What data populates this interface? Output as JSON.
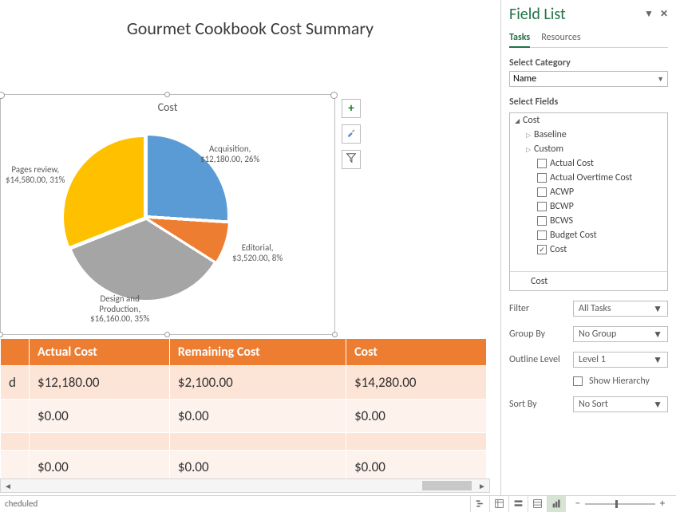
{
  "report": {
    "title": "Gourmet Cookbook Cost Summary",
    "chart_title": "Cost"
  },
  "chart_data": {
    "type": "pie",
    "title": "Cost",
    "series": [
      {
        "name": "Acquisition",
        "value": 12180.0,
        "pct": 26,
        "label": "Acquisition,\n$12,180.00, 26%",
        "color": "#5b9bd5"
      },
      {
        "name": "Editorial",
        "value": 3520.0,
        "pct": 8,
        "label": "Editorial,\n$3,520.00, 8%",
        "color": "#ed7d31"
      },
      {
        "name": "Design and Production",
        "value": 16160.0,
        "pct": 35,
        "label": "Design and\nProduction,\n$16,160.00, 35%",
        "color": "#a5a5a5"
      },
      {
        "name": "Pages review",
        "value": 14580.0,
        "pct": 31,
        "label": "Pages review,\n$14,580.00, 31%",
        "color": "#ffc000"
      }
    ]
  },
  "table": {
    "first_col_partial": "d",
    "headers": [
      "Actual Cost",
      "Remaining Cost",
      "Cost"
    ],
    "rows": [
      [
        "$12,180.00",
        "$2,100.00",
        "$14,280.00"
      ],
      [
        "$0.00",
        "$0.00",
        "$0.00"
      ],
      [
        "$0.00",
        "$0.00",
        "$0.00"
      ]
    ]
  },
  "field_list": {
    "title": "Field List",
    "tabs": {
      "tasks": "Tasks",
      "resources": "Resources"
    },
    "select_category_label": "Select Category",
    "select_category_value": "Name",
    "select_fields_label": "Select Fields",
    "tree": {
      "root": "Cost",
      "children": [
        {
          "label": "Baseline",
          "expanded": false
        },
        {
          "label": "Custom",
          "expanded": false
        }
      ],
      "leaves": [
        {
          "label": "Actual Cost",
          "checked": false
        },
        {
          "label": "Actual Overtime Cost",
          "checked": false
        },
        {
          "label": "ACWP",
          "checked": false
        },
        {
          "label": "BCWP",
          "checked": false
        },
        {
          "label": "BCWS",
          "checked": false
        },
        {
          "label": "Budget Cost",
          "checked": false
        },
        {
          "label": "Cost",
          "checked": true
        }
      ],
      "footer": "Cost"
    },
    "filter": {
      "label": "Filter",
      "value": "All Tasks"
    },
    "group_by": {
      "label": "Group By",
      "value": "No Group"
    },
    "outline_level": {
      "label": "Outline Level",
      "value": "Level 1"
    },
    "show_hierarchy": {
      "label": "Show Hierarchy",
      "checked": false
    },
    "sort_by": {
      "label": "Sort By",
      "value": "No Sort"
    }
  },
  "status": {
    "left_text": "cheduled"
  }
}
